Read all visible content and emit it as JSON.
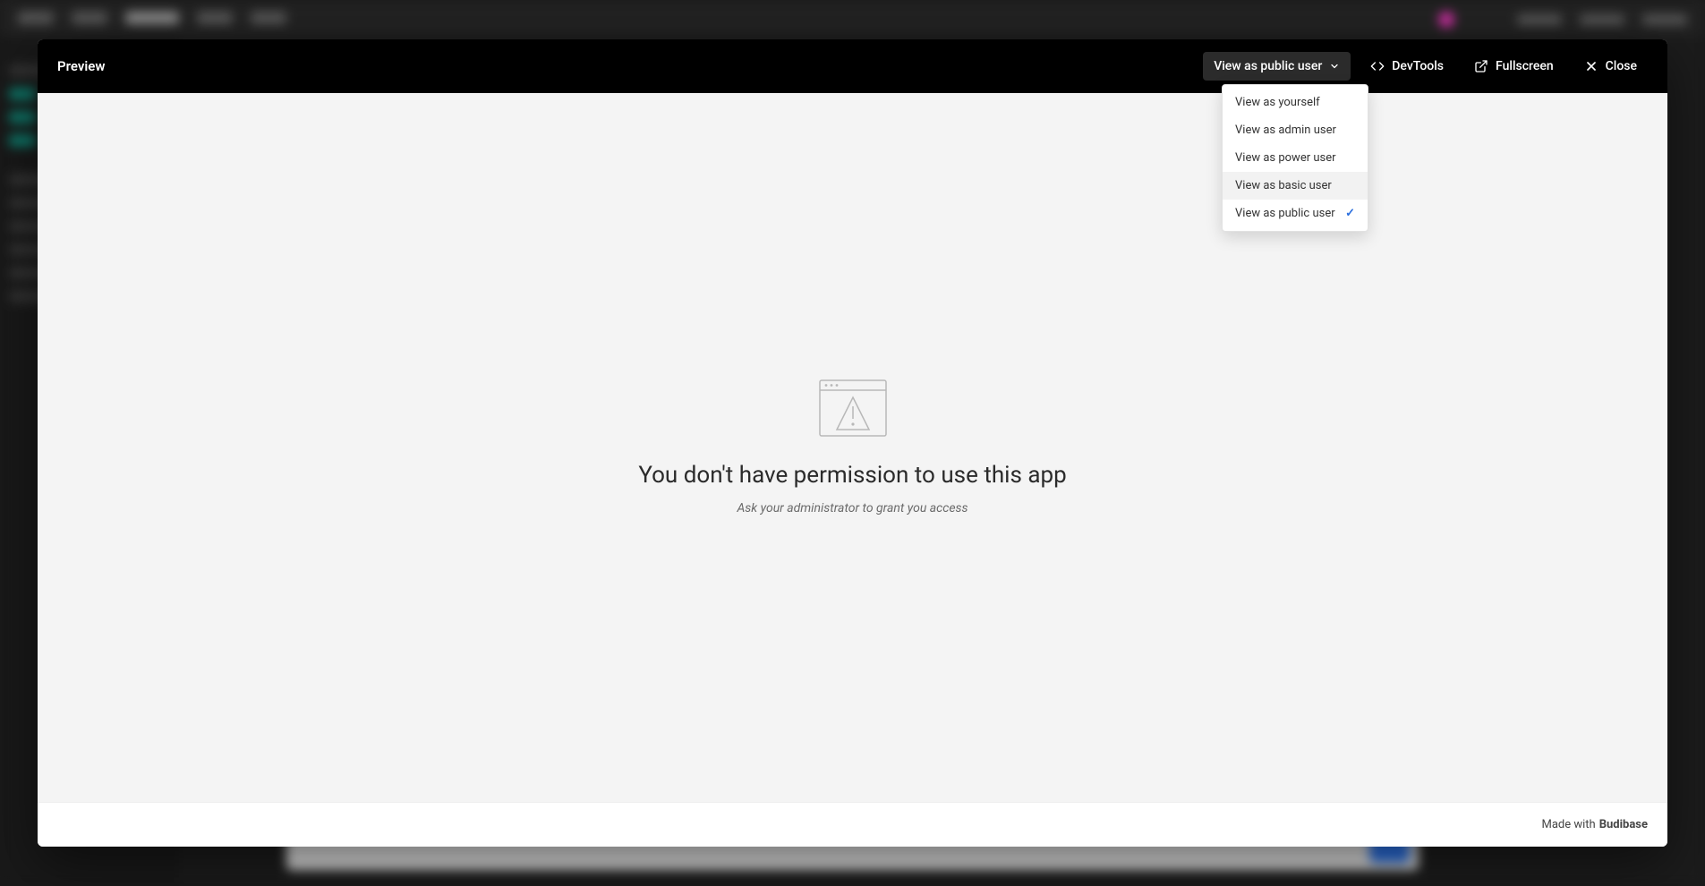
{
  "modal": {
    "title": "Preview",
    "header_actions": {
      "view_as": {
        "label": "View as public user"
      },
      "devtools": {
        "label": "DevTools"
      },
      "fullscreen": {
        "label": "Fullscreen"
      },
      "close": {
        "label": "Close"
      }
    },
    "view_as_menu": {
      "items": [
        {
          "label": "View as yourself",
          "selected": false,
          "hover": false
        },
        {
          "label": "View as admin user",
          "selected": false,
          "hover": false
        },
        {
          "label": "View as power user",
          "selected": false,
          "hover": false
        },
        {
          "label": "View as basic user",
          "selected": false,
          "hover": true
        },
        {
          "label": "View as public user",
          "selected": true,
          "hover": false
        }
      ]
    },
    "body": {
      "title": "You don't have permission to use this app",
      "subtitle": "Ask your administrator to grant you access"
    },
    "footer": {
      "prefix": "Made with",
      "brand": "Budibase"
    }
  }
}
